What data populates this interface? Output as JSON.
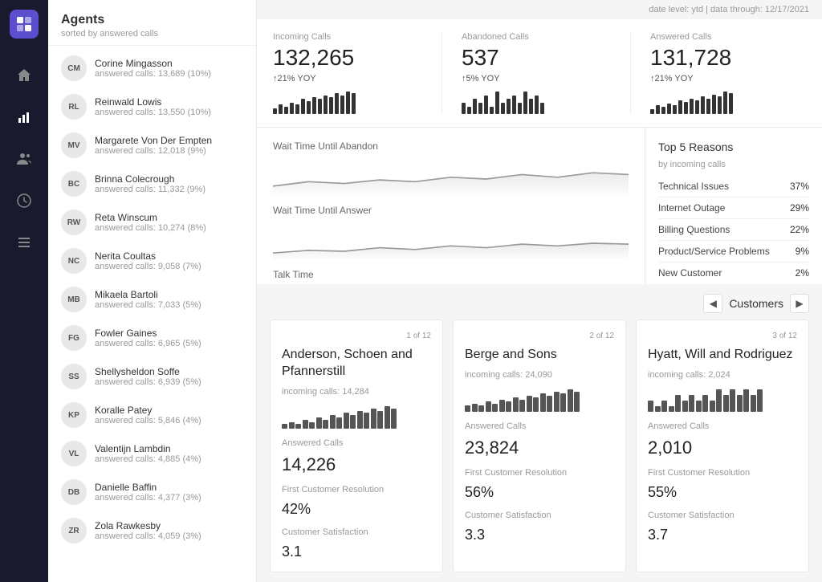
{
  "app": {
    "logo_icon": "grid-icon",
    "nav_items": [
      {
        "icon": "home-icon",
        "label": "Home",
        "active": false
      },
      {
        "icon": "chart-icon",
        "label": "Analytics",
        "active": true
      },
      {
        "icon": "people-icon",
        "label": "People",
        "active": false
      },
      {
        "icon": "clock-icon",
        "label": "Time",
        "active": false
      },
      {
        "icon": "menu-icon",
        "label": "Menu",
        "active": false
      }
    ]
  },
  "agents": {
    "title": "Agents",
    "subtitle": "sorted by answered calls",
    "list": [
      {
        "initials": "CM",
        "name": "Corine Mingasson",
        "calls": "answered calls: 13,689 (10%)"
      },
      {
        "initials": "RL",
        "name": "Reinwald Lowis",
        "calls": "answered calls: 13,550 (10%)"
      },
      {
        "initials": "MV",
        "name": "Margarete Von Der Empten",
        "calls": "answered calls: 12,018 (9%)"
      },
      {
        "initials": "BC",
        "name": "Brinna Colecrough",
        "calls": "answered calls: 11,332 (9%)"
      },
      {
        "initials": "RW",
        "name": "Reta Winscum",
        "calls": "answered calls: 10,274 (8%)"
      },
      {
        "initials": "NC",
        "name": "Nerita Coultas",
        "calls": "answered calls: 9,058 (7%)"
      },
      {
        "initials": "MB",
        "name": "Mikaela Bartoli",
        "calls": "answered calls: 7,033 (5%)"
      },
      {
        "initials": "FG",
        "name": "Fowler Gaines",
        "calls": "answered calls: 6,965 (5%)"
      },
      {
        "initials": "SS",
        "name": "Shellysheldon Soffe",
        "calls": "answered calls: 6,939 (5%)"
      },
      {
        "initials": "KP",
        "name": "Koralle Patey",
        "calls": "answered calls: 5,846 (4%)"
      },
      {
        "initials": "VL",
        "name": "Valentijn Lambdin",
        "calls": "answered calls: 4,885 (4%)"
      },
      {
        "initials": "DB",
        "name": "Danielle Baffin",
        "calls": "answered calls: 4,377 (3%)"
      },
      {
        "initials": "ZR",
        "name": "Zola Rawkesby",
        "calls": "answered calls: 4,059 (3%)"
      }
    ]
  },
  "date_header": "date level: ytd | data through: 12/17/2021",
  "metrics": [
    {
      "label": "Incoming Calls",
      "value": "132,265",
      "yoy": "↑21% YOY",
      "bars": [
        3,
        5,
        4,
        6,
        5,
        8,
        7,
        9,
        8,
        10,
        9,
        11,
        10,
        12,
        11
      ]
    },
    {
      "label": "Abandoned Calls",
      "value": "537",
      "yoy": "↑5% YOY",
      "bars": [
        3,
        2,
        4,
        3,
        5,
        2,
        6,
        3,
        4,
        5,
        3,
        6,
        4,
        5,
        3
      ]
    },
    {
      "label": "Answered Calls",
      "value": "131,728",
      "yoy": "↑21% YOY",
      "bars": [
        3,
        5,
        4,
        6,
        5,
        8,
        7,
        9,
        8,
        10,
        9,
        11,
        10,
        13,
        12
      ]
    }
  ],
  "charts": [
    {
      "label": "Wait Time Until Abandon"
    },
    {
      "label": "Wait Time Until Answer"
    },
    {
      "label": "Talk Time"
    }
  ],
  "top5reasons": {
    "title": "Top 5 Reasons",
    "subtitle": "by incoming calls",
    "items": [
      {
        "name": "Technical Issues",
        "pct": "37%"
      },
      {
        "name": "Internet Outage",
        "pct": "29%"
      },
      {
        "name": "Billing Questions",
        "pct": "22%"
      },
      {
        "name": "Product/Service Problems",
        "pct": "9%"
      },
      {
        "name": "New Customer",
        "pct": "2%"
      }
    ]
  },
  "customers": {
    "label": "Customers",
    "nav_prev": "◀",
    "nav_next": "▶",
    "cards": [
      {
        "num": "1 of 12",
        "name": "Anderson, Schoen and Pfannerstill",
        "incoming": "incoming calls: 14,284",
        "spark_bars": [
          2,
          3,
          2,
          4,
          3,
          5,
          4,
          6,
          5,
          7,
          6,
          8,
          7,
          9,
          8,
          10,
          9
        ],
        "answered_label": "Answered Calls",
        "answered_value": "14,226",
        "fcr_label": "First Customer Resolution",
        "fcr_value": "42%",
        "csat_label": "Customer Satisfaction",
        "csat_value": "3.1"
      },
      {
        "num": "2 of 12",
        "name": "Berge and Sons",
        "incoming": "incoming calls: 24,090",
        "spark_bars": [
          3,
          4,
          3,
          5,
          4,
          6,
          5,
          7,
          6,
          8,
          7,
          9,
          8,
          10,
          9,
          11,
          10
        ],
        "answered_label": "Answered Calls",
        "answered_value": "23,824",
        "fcr_label": "First Customer Resolution",
        "fcr_value": "56%",
        "csat_label": "Customer Satisfaction",
        "csat_value": "3.3"
      },
      {
        "num": "3 of 12",
        "name": "Hyatt, Will and Rodriguez",
        "incoming": "incoming calls: 2,024",
        "spark_bars": [
          2,
          1,
          2,
          1,
          3,
          2,
          3,
          2,
          3,
          2,
          4,
          3,
          4,
          3,
          4,
          3,
          4
        ],
        "answered_label": "Answered Calls",
        "answered_value": "2,010",
        "fcr_label": "First Customer Resolution",
        "fcr_value": "55%",
        "csat_label": "Customer Satisfaction",
        "csat_value": "3.7"
      }
    ]
  }
}
